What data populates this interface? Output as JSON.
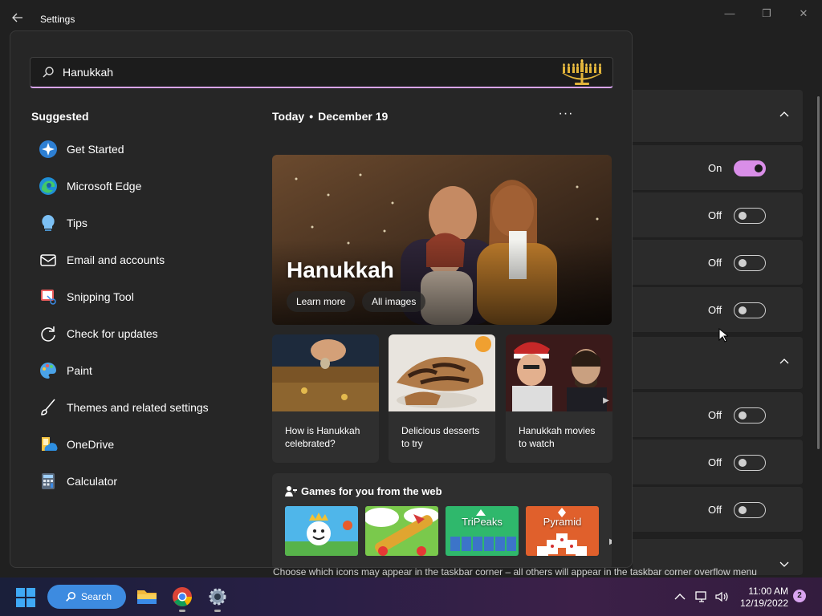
{
  "window": {
    "title": "Settings",
    "back_icon": "arrow-left-icon",
    "controls": [
      "minimize-icon",
      "maximize-icon",
      "close-icon"
    ]
  },
  "settings_rows": [
    {
      "state": "On"
    },
    {
      "state": "Off"
    },
    {
      "state": "Off"
    },
    {
      "state": "Off"
    },
    {
      "state": "Off"
    },
    {
      "state": "Off"
    },
    {
      "state": "Off"
    }
  ],
  "footer_text": "Choose which icons may appear in the taskbar corner – all others will appear in the taskbar corner overflow menu",
  "search": {
    "value": "Hanukkah",
    "icon": "search-icon"
  },
  "suggested": {
    "title": "Suggested",
    "items": [
      {
        "label": "Get Started",
        "icon": "get-started-icon"
      },
      {
        "label": "Microsoft Edge",
        "icon": "edge-icon"
      },
      {
        "label": "Tips",
        "icon": "tips-icon"
      },
      {
        "label": "Email and accounts",
        "icon": "mail-icon"
      },
      {
        "label": "Snipping Tool",
        "icon": "snipping-tool-icon"
      },
      {
        "label": "Check for updates",
        "icon": "refresh-icon"
      },
      {
        "label": "Paint",
        "icon": "paint-icon"
      },
      {
        "label": "Themes and related settings",
        "icon": "brush-icon"
      },
      {
        "label": "OneDrive",
        "icon": "onedrive-icon"
      },
      {
        "label": "Calculator",
        "icon": "calculator-icon"
      }
    ]
  },
  "today": {
    "label": "Today",
    "separator": "•",
    "date": "December 19",
    "more": "···"
  },
  "hero": {
    "title": "Hanukkah",
    "learn_more": "Learn more",
    "all_images": "All images"
  },
  "tiles": [
    {
      "caption": "How is Hanukkah celebrated?"
    },
    {
      "caption": "Delicious desserts to try"
    },
    {
      "caption": "Hanukkah movies to watch"
    }
  ],
  "games": {
    "title": "Games for you from the web",
    "items": [
      {
        "name": ""
      },
      {
        "name": ""
      },
      {
        "name": "TriPeaks"
      },
      {
        "name": "Pyramid"
      }
    ]
  },
  "taskbar": {
    "search_label": "Search",
    "time": "11:00 AM",
    "date": "12/19/2022",
    "notification_count": "2"
  },
  "colors": {
    "accent": "#d9a4f0",
    "taskbar_search": "#3d8be0",
    "panel_bg": "#262626"
  }
}
